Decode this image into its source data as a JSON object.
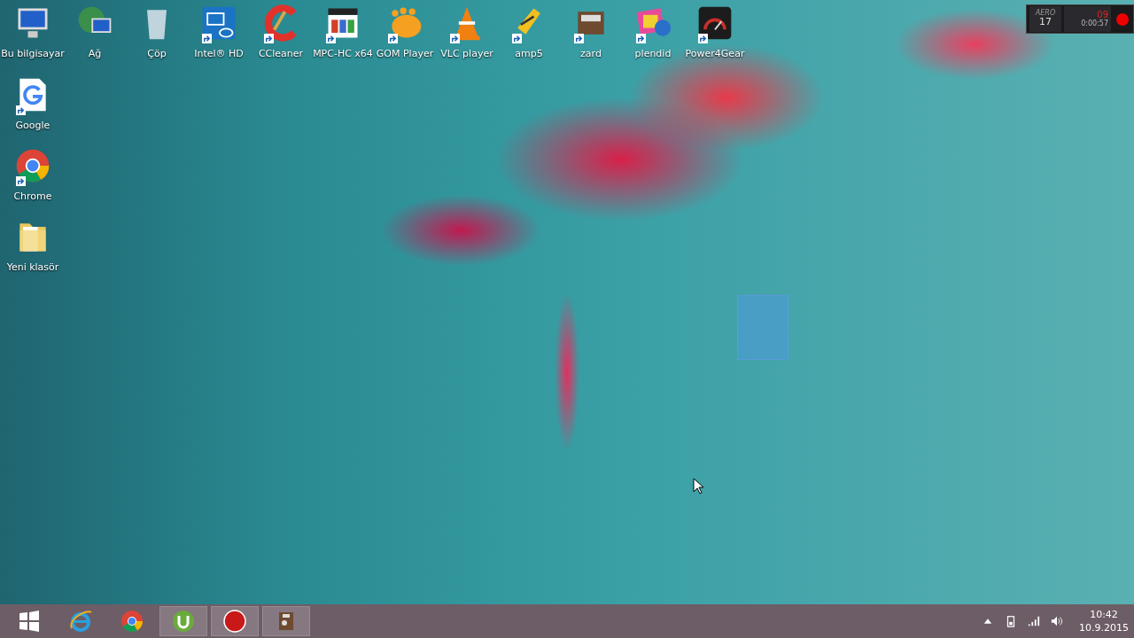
{
  "desktop": {
    "top_row": [
      {
        "label": "Bu bilgisayar",
        "kind": "computer",
        "shortcut": false
      },
      {
        "label": "Ağ",
        "kind": "network",
        "shortcut": false
      },
      {
        "label": "Çöp",
        "kind": "trash",
        "shortcut": false
      },
      {
        "label": "Intel® HD",
        "kind": "intel",
        "shortcut": true
      },
      {
        "label": "CCleaner",
        "kind": "ccleaner",
        "shortcut": true
      },
      {
        "label": "MPC-HC x64",
        "kind": "mpc",
        "shortcut": true
      },
      {
        "label": "GOM Player",
        "kind": "gom",
        "shortcut": true
      },
      {
        "label": "VLC player",
        "kind": "vlc",
        "shortcut": true
      },
      {
        "label": "amp5",
        "kind": "winamp",
        "shortcut": true
      },
      {
        "label": "zard",
        "kind": "box",
        "shortcut": true
      },
      {
        "label": "plendid",
        "kind": "splendid",
        "shortcut": true
      },
      {
        "label": "Power4Gear",
        "kind": "gauge",
        "shortcut": true
      }
    ],
    "left_column": [
      {
        "label": "Google",
        "kind": "google",
        "shortcut": true
      },
      {
        "label": "Chrome",
        "kind": "chrome",
        "shortcut": true
      },
      {
        "label": "Yeni klasör",
        "kind": "folder",
        "shortcut": false
      }
    ]
  },
  "recorder_hud": {
    "mode": "AERO",
    "fps": "17",
    "frames": "09",
    "elapsed": "0:00:57"
  },
  "taskbar": {
    "items": [
      {
        "kind": "start",
        "open": false
      },
      {
        "kind": "ie",
        "open": false
      },
      {
        "kind": "chrome",
        "open": false
      },
      {
        "kind": "utorrent",
        "open": true
      },
      {
        "kind": "record",
        "open": true
      },
      {
        "kind": "app",
        "open": true
      }
    ],
    "tray": {
      "time": "10:42",
      "date": "10.9.2015"
    }
  }
}
